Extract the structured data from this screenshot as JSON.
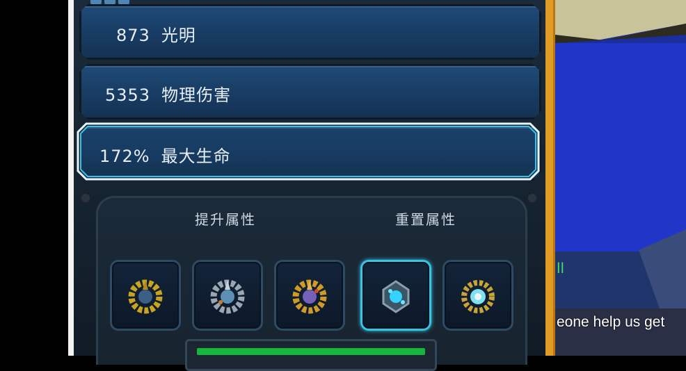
{
  "stats": [
    {
      "value": "873",
      "name": "光明"
    },
    {
      "value": "5353",
      "name": "物理伤害"
    },
    {
      "value": "172%",
      "name": "最大生命",
      "selected": true
    }
  ],
  "sections": {
    "upgrade_label": "提升属性",
    "reset_label": "重置属性"
  },
  "gem_slots": [
    {
      "name": "gold-gem",
      "color": "#c9a421",
      "core": "#3b5f86"
    },
    {
      "name": "silver-gem",
      "color": "#9aa7b3",
      "core": "#5c8fb5"
    },
    {
      "name": "amber-gem",
      "color": "#d19a25",
      "core": "#7661b8"
    },
    {
      "name": "cyan-gem",
      "color": "#5fb7c9",
      "core": "#33d2ff",
      "active": true
    },
    {
      "name": "teal-gold-gem",
      "color": "#c8a437",
      "core": "#7fe0ee"
    }
  ],
  "chat": {
    "text": "eone help us get",
    "marker": "ll"
  },
  "colors": {
    "accent": "#39c3e6",
    "orange_frame": "#e09b24",
    "green_bar": "#16b53b"
  }
}
